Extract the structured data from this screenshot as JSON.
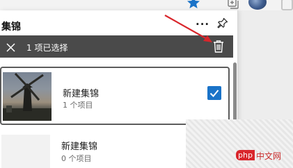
{
  "panel": {
    "title": "集锦",
    "more_icon": "more-horizontal-icon",
    "pin_icon": "pin-icon"
  },
  "selection_bar": {
    "close_icon": "close-icon",
    "count_text": "1 项已选择",
    "delete_icon": "trash-icon"
  },
  "items": [
    {
      "title": "新建集锦",
      "subtitle": "1 个项目",
      "selected": true
    },
    {
      "title": "新建集锦",
      "subtitle": "0 个项目",
      "selected": false
    }
  ],
  "watermark": {
    "badge": "php",
    "text": "中文网"
  },
  "colors": {
    "selection_bar": "#4a4a4a",
    "checkbox": "#1a73c8",
    "arrow": "#d9262c",
    "accent_star": "#1a73c8"
  }
}
